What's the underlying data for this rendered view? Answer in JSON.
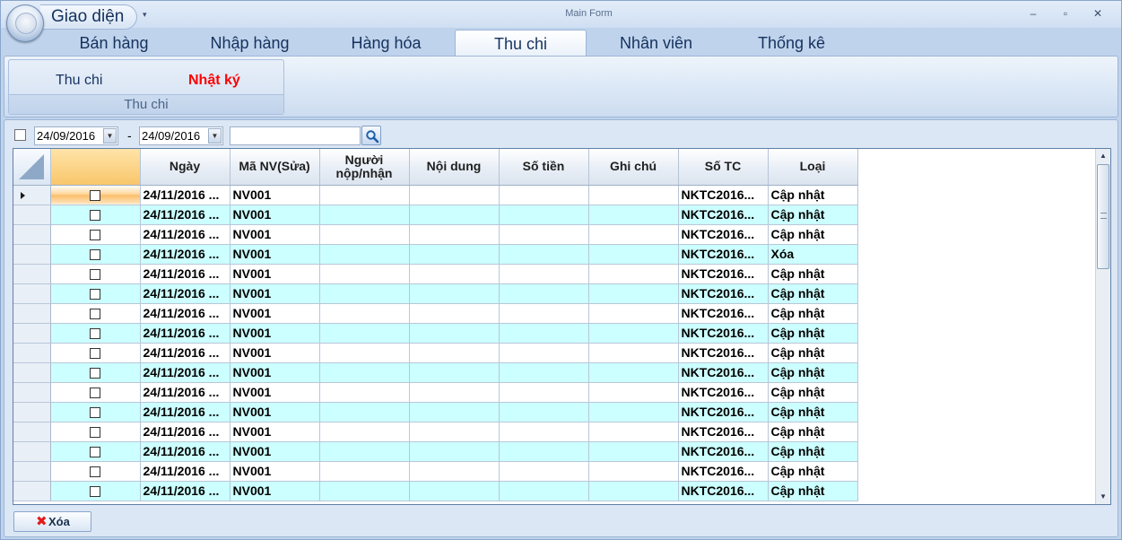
{
  "app": {
    "menu_label": "Giao diện",
    "window_title": "Main Form",
    "qa_arrow": "▾",
    "controls": {
      "minimize": "–",
      "maximize": "▫",
      "close": "✕"
    }
  },
  "tabs": [
    {
      "label": "Bán hàng"
    },
    {
      "label": "Nhập hàng"
    },
    {
      "label": "Hàng hóa"
    },
    {
      "label": "Thu chi"
    },
    {
      "label": "Nhân viên"
    },
    {
      "label": "Thống kê"
    }
  ],
  "active_tab": "Thu chi",
  "ribbon": {
    "group_label": "Thu chi",
    "buttons": [
      {
        "label": "Thu chi"
      },
      {
        "label": "Nhật ký"
      }
    ],
    "highlight_color": "#ff0000"
  },
  "filter": {
    "from_date": "24/09/2016",
    "dash": "-",
    "to_date": "24/09/2016",
    "search_value": ""
  },
  "grid": {
    "columns": [
      "",
      "Ngày",
      "Mã NV(Sửa)",
      "Người nộp/nhận",
      "Nội dung",
      "Số tiền",
      "Ghi chú",
      "Số TC",
      "Loại"
    ],
    "rows": [
      {
        "ngay": "24/11/2016 ...",
        "manv": "NV001",
        "nguoi": "",
        "noidung": "",
        "sotien": "",
        "ghichu": "",
        "sotc": "NKTC2016...",
        "loai": "Cập nhật"
      },
      {
        "ngay": "24/11/2016 ...",
        "manv": "NV001",
        "nguoi": "",
        "noidung": "",
        "sotien": "",
        "ghichu": "",
        "sotc": "NKTC2016...",
        "loai": "Cập nhật"
      },
      {
        "ngay": "24/11/2016 ...",
        "manv": "NV001",
        "nguoi": "",
        "noidung": "",
        "sotien": "",
        "ghichu": "",
        "sotc": "NKTC2016...",
        "loai": "Cập nhật"
      },
      {
        "ngay": "24/11/2016 ...",
        "manv": "NV001",
        "nguoi": "",
        "noidung": "",
        "sotien": "",
        "ghichu": "",
        "sotc": "NKTC2016...",
        "loai": "Xóa"
      },
      {
        "ngay": "24/11/2016 ...",
        "manv": "NV001",
        "nguoi": "",
        "noidung": "",
        "sotien": "",
        "ghichu": "",
        "sotc": "NKTC2016...",
        "loai": "Cập nhật"
      },
      {
        "ngay": "24/11/2016 ...",
        "manv": "NV001",
        "nguoi": "",
        "noidung": "",
        "sotien": "",
        "ghichu": "",
        "sotc": "NKTC2016...",
        "loai": "Cập nhật"
      },
      {
        "ngay": "24/11/2016 ...",
        "manv": "NV001",
        "nguoi": "",
        "noidung": "",
        "sotien": "",
        "ghichu": "",
        "sotc": "NKTC2016...",
        "loai": "Cập nhật"
      },
      {
        "ngay": "24/11/2016 ...",
        "manv": "NV001",
        "nguoi": "",
        "noidung": "",
        "sotien": "",
        "ghichu": "",
        "sotc": "NKTC2016...",
        "loai": "Cập nhật"
      },
      {
        "ngay": "24/11/2016 ...",
        "manv": "NV001",
        "nguoi": "",
        "noidung": "",
        "sotien": "",
        "ghichu": "",
        "sotc": "NKTC2016...",
        "loai": "Cập nhật"
      },
      {
        "ngay": "24/11/2016 ...",
        "manv": "NV001",
        "nguoi": "",
        "noidung": "",
        "sotien": "",
        "ghichu": "",
        "sotc": "NKTC2016...",
        "loai": "Cập nhật"
      },
      {
        "ngay": "24/11/2016 ...",
        "manv": "NV001",
        "nguoi": "",
        "noidung": "",
        "sotien": "",
        "ghichu": "",
        "sotc": "NKTC2016...",
        "loai": "Cập nhật"
      },
      {
        "ngay": "24/11/2016 ...",
        "manv": "NV001",
        "nguoi": "",
        "noidung": "",
        "sotien": "",
        "ghichu": "",
        "sotc": "NKTC2016...",
        "loai": "Cập nhật"
      },
      {
        "ngay": "24/11/2016 ...",
        "manv": "NV001",
        "nguoi": "",
        "noidung": "",
        "sotien": "",
        "ghichu": "",
        "sotc": "NKTC2016...",
        "loai": "Cập nhật"
      },
      {
        "ngay": "24/11/2016 ...",
        "manv": "NV001",
        "nguoi": "",
        "noidung": "",
        "sotien": "",
        "ghichu": "",
        "sotc": "NKTC2016...",
        "loai": "Cập nhật"
      },
      {
        "ngay": "24/11/2016 ...",
        "manv": "NV001",
        "nguoi": "",
        "noidung": "",
        "sotien": "",
        "ghichu": "",
        "sotc": "NKTC2016...",
        "loai": "Cập nhật"
      },
      {
        "ngay": "24/11/2016 ...",
        "manv": "NV001",
        "nguoi": "",
        "noidung": "",
        "sotien": "",
        "ghichu": "",
        "sotc": "NKTC2016...",
        "loai": "Cập nhật"
      }
    ],
    "alt_row_color": "#ccffff"
  },
  "actions": {
    "delete_label": "Xóa"
  }
}
